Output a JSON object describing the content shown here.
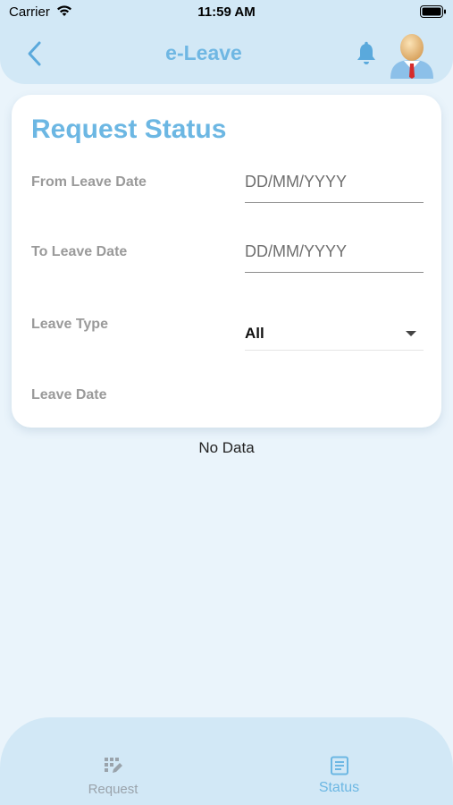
{
  "status_bar": {
    "carrier": "Carrier",
    "time": "11:59 AM"
  },
  "nav": {
    "title": "e-Leave",
    "back_icon": "chevron-left-icon",
    "bell_icon": "bell-icon",
    "avatar_icon": "user-avatar"
  },
  "card": {
    "title": "Request Status",
    "from_label": "From Leave Date",
    "from_placeholder": "DD/MM/YYYY",
    "to_label": "To Leave Date",
    "to_placeholder": "DD/MM/YYYY",
    "type_label": "Leave Type",
    "type_value": "All",
    "leave_date_label": "Leave Date"
  },
  "results": {
    "empty_text": "No Data"
  },
  "tabs": [
    {
      "label": "Request",
      "icon": "edit-grid-icon",
      "active": false
    },
    {
      "label": "Status",
      "icon": "document-list-icon",
      "active": true
    }
  ],
  "colors": {
    "accent": "#6cb7e3",
    "header_bg": "#d2e8f6",
    "page_bg": "#eaf4fb",
    "inactive_tab": "#9aa3ab"
  }
}
